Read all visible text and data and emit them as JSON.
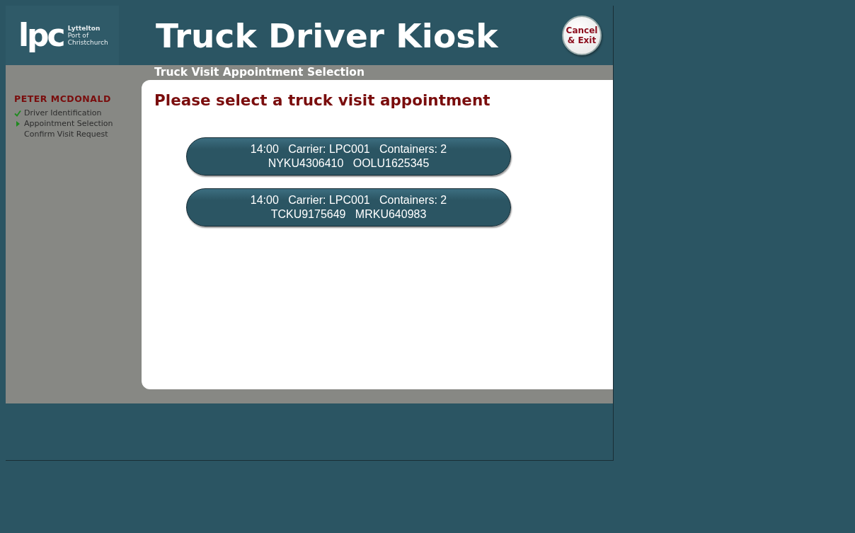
{
  "header": {
    "logo_mark": "lpc",
    "logo_lines": [
      "Lyttelton",
      "Port of",
      "Christchurch"
    ],
    "title": "Truck Driver Kiosk",
    "cancel_button": [
      "Cancel",
      "& Exit"
    ]
  },
  "sidebar": {
    "driver_name": "PETER MCDONALD",
    "steps": [
      {
        "label": "Driver Identification",
        "kind": "done"
      },
      {
        "label": "Appointment Selection",
        "kind": "current"
      },
      {
        "label": "Confirm Visit Request",
        "kind": "pending"
      }
    ]
  },
  "page_title": "Truck Visit Appointment Selection",
  "prompt": "Please select a truck visit appointment",
  "appointments": [
    {
      "line1": "14:00   Carrier: LPC001   Containers: 2",
      "line2": "NYKU4306410   OOLU1625345"
    },
    {
      "line1": "14:00   Carrier: LPC001   Containers: 2",
      "line2": "TCKU9175649   MRKU640983"
    }
  ]
}
